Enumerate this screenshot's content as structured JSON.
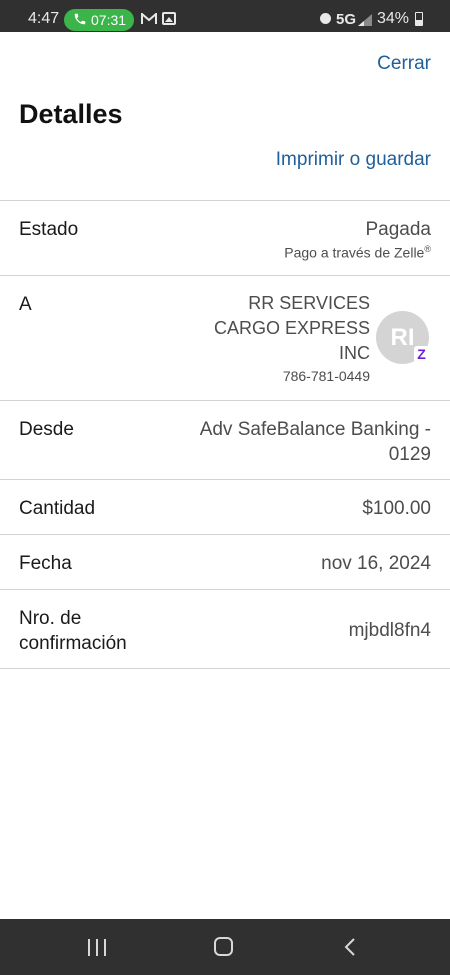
{
  "status_bar": {
    "time": "4:47",
    "call_time": "07:31",
    "network": "5G",
    "battery": "34%",
    "icons": [
      "phone-icon",
      "gmail-icon",
      "photo-icon",
      "alarm-icon",
      "signal-icon",
      "battery-icon"
    ]
  },
  "header": {
    "close_label": "Cerrar",
    "title": "Detalles",
    "print_label": "Imprimir o guardar"
  },
  "details": {
    "status": {
      "label": "Estado",
      "value": "Pagada",
      "sub_text": "Pago a través de Zelle",
      "sub_mark": "®"
    },
    "to": {
      "label": "A",
      "name_line1": "RR SERVICES",
      "name_line2": "CARGO EXPRESS",
      "name_line3": "INC",
      "phone": "786-781-0449",
      "avatar_initials": "RI",
      "badge": "Z"
    },
    "from": {
      "label": "Desde",
      "value_line1": "Adv SafeBalance Banking -",
      "value_line2": "0129"
    },
    "amount": {
      "label": "Cantidad",
      "value": "$100.00"
    },
    "date": {
      "label": "Fecha",
      "value": "nov 16, 2024"
    },
    "confirmation": {
      "label_line1": "Nro. de",
      "label_line2": "confirmación",
      "value": "mjbdl8fn4"
    }
  },
  "colors": {
    "link": "#1f5f9a",
    "zelle": "#6d1ed4",
    "call_pill": "#3bb54a",
    "system_bar": "#303030"
  }
}
